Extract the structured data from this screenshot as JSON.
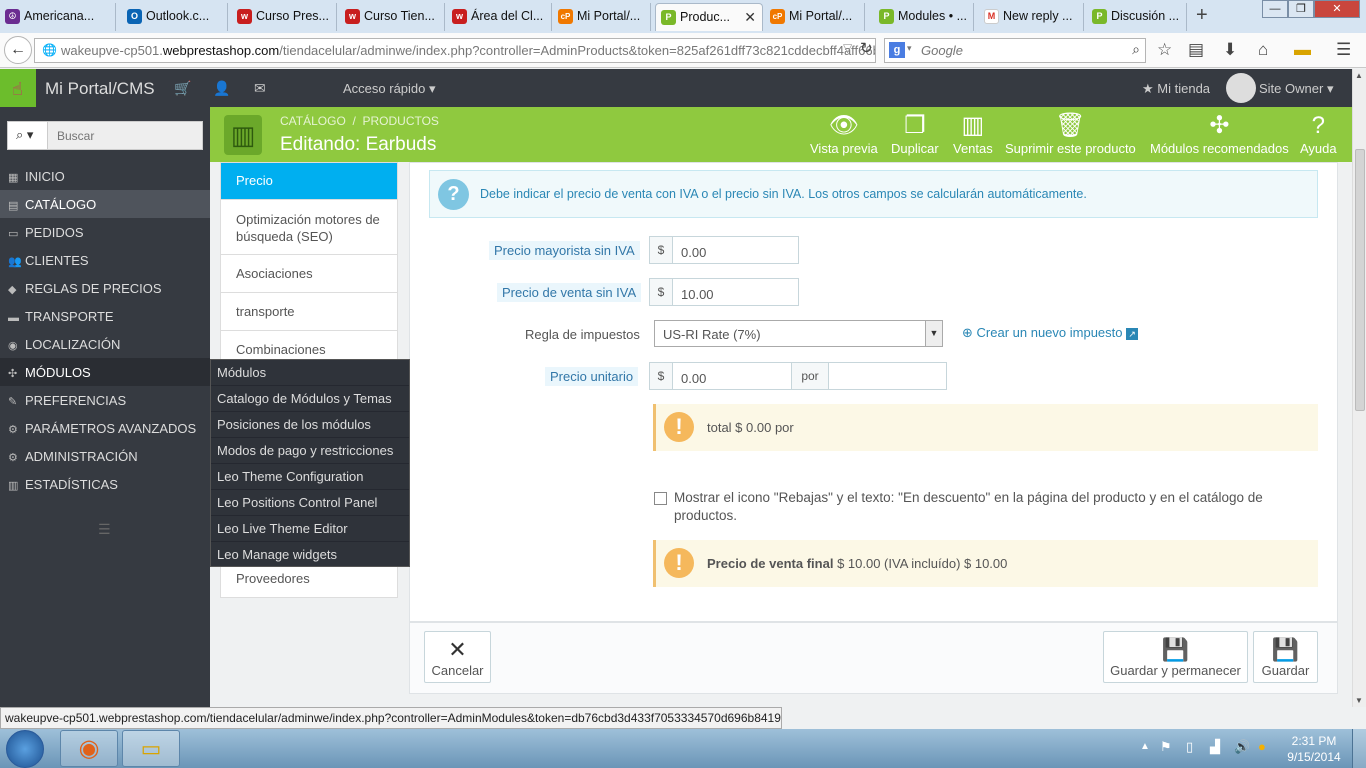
{
  "browser": {
    "tabs": [
      {
        "label": "Americana...",
        "color": "#6b2c91",
        "glyph": "☮"
      },
      {
        "label": "Outlook.c...",
        "color": "#0a64b4",
        "glyph": "O"
      },
      {
        "label": "Curso Pres...",
        "color": "#c81e1e",
        "glyph": "w"
      },
      {
        "label": "Curso Tien...",
        "color": "#c81e1e",
        "glyph": "w"
      },
      {
        "label": "Área del Cl...",
        "color": "#c81e1e",
        "glyph": "w"
      },
      {
        "label": "Mi Portal/...",
        "color": "#f07800",
        "glyph": "cP"
      },
      {
        "label": "Produc...",
        "color": "#7ab829",
        "glyph": "P"
      },
      {
        "label": "Mi Portal/...",
        "color": "#f07800",
        "glyph": "cP"
      },
      {
        "label": "Modules • ...",
        "color": "#7ab829",
        "glyph": "P"
      },
      {
        "label": "New reply ...",
        "color": "#d93025",
        "glyph": "M"
      },
      {
        "label": "Discusión ...",
        "color": "#7ab829",
        "glyph": "P"
      }
    ],
    "active_tab_close": "✕",
    "new_tab": "+",
    "url_prefix": "wakeupve-cp501.",
    "url_domain": "webprestashop.com",
    "url_rest": "/tiendacelular/adminwe/index.php?controller=AdminProducts&token=825af261dff73c821cddecbff4aff66b&ic",
    "search_placeholder": "Google",
    "window_controls": [
      "—",
      "❐",
      "✕"
    ]
  },
  "topbar": {
    "brand": "Mi Portal/CMS",
    "quick_access": "Acceso rápido",
    "my_store": "Mi tienda",
    "user": "Site Owner"
  },
  "sidebar": {
    "search_placeholder": "Buscar",
    "items": [
      {
        "label": "Inicio",
        "icon": "▦"
      },
      {
        "label": "Catálogo",
        "icon": "▤"
      },
      {
        "label": "Pedidos",
        "icon": "▭"
      },
      {
        "label": "Clientes",
        "icon": "👥"
      },
      {
        "label": "Reglas de precios",
        "icon": "◆"
      },
      {
        "label": "Transporte",
        "icon": "▬"
      },
      {
        "label": "Localización",
        "icon": "◉"
      },
      {
        "label": "Módulos",
        "icon": "✣"
      },
      {
        "label": "Preferencias",
        "icon": "✎"
      },
      {
        "label": "Parámetros avanzados",
        "icon": "⚙"
      },
      {
        "label": "Administración",
        "icon": "⚙"
      },
      {
        "label": "Estadísticas",
        "icon": "▥"
      }
    ],
    "flyout": [
      "Módulos",
      "Catalogo de Módulos y Temas",
      "Posiciones de los módulos",
      "Modos de pago y restricciones",
      "Leo Theme Configuration",
      "Leo Positions Control Panel",
      "Leo Live Theme Editor",
      "Leo Manage widgets"
    ]
  },
  "header": {
    "breadcrumb1": "CATÁLOGO",
    "breadcrumb_sep": "/",
    "breadcrumb2": "PRODUCTOS",
    "title": "Editando: Earbuds",
    "actions": [
      {
        "label": "Vista previa",
        "icon": "eye-icon"
      },
      {
        "label": "Duplicar",
        "icon": "copy-icon"
      },
      {
        "label": "Ventas",
        "icon": "bar-chart-icon"
      },
      {
        "label": "Suprimir este producto",
        "icon": "trash-icon"
      },
      {
        "label": "Módulos recomendados",
        "icon": "puzzle-icon"
      },
      {
        "label": "Ayuda",
        "icon": "help-icon"
      }
    ]
  },
  "product_tabs": [
    "Precio",
    "Optimización motores de búsqueda (SEO)",
    "Asociaciones",
    "transporte",
    "Combinaciones",
    "Proveedores"
  ],
  "form": {
    "info": "Debe indicar el precio de venta con IVA o el precio sin IVA. Los otros campos se calcularán automáticamente.",
    "wholesale_label": "Precio mayorista sin IVA",
    "currency": "$",
    "wholesale_value": "0.00",
    "retail_label": "Precio de venta sin IVA",
    "retail_value": "10.00",
    "tax_label": "Regla de impuestos",
    "tax_value": "US-RI Rate (7%)",
    "new_tax_link": "Crear un nuevo impuesto",
    "unit_label": "Precio unitario",
    "unit_value": "0.00",
    "per": "por",
    "total_text": "total $ 0.00 por",
    "discount_text": "Mostrar el icono \"Rebajas\" y el texto: \"En descuento\" en la página del producto y en el catálogo de productos.",
    "final_label": "Precio de venta final",
    "final_text": "$ 10.00 (IVA incluído) $ 10.00"
  },
  "footer": {
    "cancel": "Cancelar",
    "save_stay": "Guardar y permanecer",
    "save": "Guardar"
  },
  "status_url": "wakeupve-cp501.webprestashop.com/tiendacelular/adminwe/index.php?controller=AdminModules&token=db76cbd3d433f7053334570d696b8419",
  "clock": {
    "time": "2:31 PM",
    "date": "9/15/2014"
  }
}
